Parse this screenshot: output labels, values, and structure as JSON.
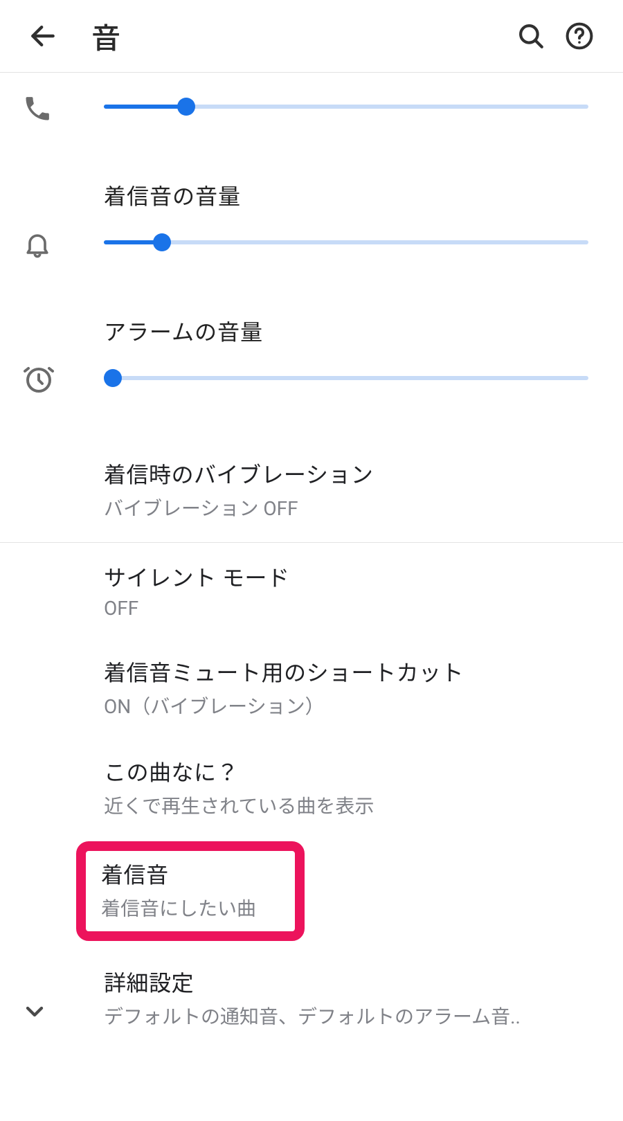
{
  "header": {
    "title": "音"
  },
  "sliders": {
    "call": {
      "percent": 17
    },
    "ring": {
      "label": "着信音の音量",
      "percent": 12
    },
    "alarm": {
      "label": "アラームの音量",
      "percent": 0
    }
  },
  "items": {
    "vibration": {
      "title": "着信時のバイブレーション",
      "sub": "バイブレーション OFF"
    },
    "silent": {
      "title": "サイレント モード",
      "sub": "OFF"
    },
    "shortcut": {
      "title": "着信音ミュート用のショートカット",
      "sub": "ON（バイブレーション）"
    },
    "nowplay": {
      "title": "この曲なに？",
      "sub": "近くで再生されている曲を表示"
    },
    "ringtone": {
      "title": "着信音",
      "sub": "着信音にしたい曲"
    },
    "advanced": {
      "title": "詳細設定",
      "sub": "デフォルトの通知音、デフォルトのアラーム音.."
    }
  },
  "colors": {
    "accent": "#1a73e8",
    "highlight": "#ec135c"
  }
}
